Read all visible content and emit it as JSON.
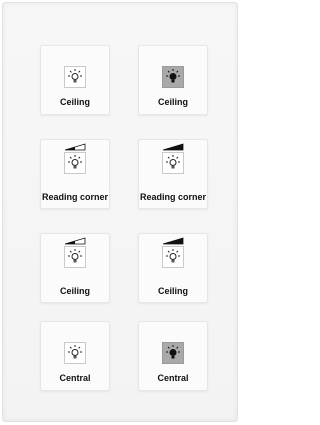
{
  "buttons": [
    {
      "label": "Ceiling",
      "state": "off",
      "icon": "bulb-icon",
      "dimmer": false,
      "dim_level": null
    },
    {
      "label": "Ceiling",
      "state": "on",
      "icon": "bulb-icon",
      "dimmer": false,
      "dim_level": null
    },
    {
      "label": "Reading corner",
      "state": "off",
      "icon": "bulb-icon",
      "dimmer": true,
      "dim_level": 0.5
    },
    {
      "label": "Reading corner",
      "state": "off",
      "icon": "bulb-icon",
      "dimmer": true,
      "dim_level": 1.0
    },
    {
      "label": "Ceiling",
      "state": "off",
      "icon": "bulb-icon",
      "dimmer": true,
      "dim_level": 0.5
    },
    {
      "label": "Ceiling",
      "state": "off",
      "icon": "bulb-icon",
      "dimmer": true,
      "dim_level": 1.0
    },
    {
      "label": "Central",
      "state": "off",
      "icon": "bulb-icon",
      "dimmer": false,
      "dim_level": null
    },
    {
      "label": "Central",
      "state": "on",
      "icon": "bulb-icon",
      "dimmer": false,
      "dim_level": null
    }
  ],
  "colors": {
    "icon_on_bg": "#a9a9a9",
    "icon_off_bg": "#ffffff",
    "text": "#111111",
    "dim_fill": "#111111"
  }
}
